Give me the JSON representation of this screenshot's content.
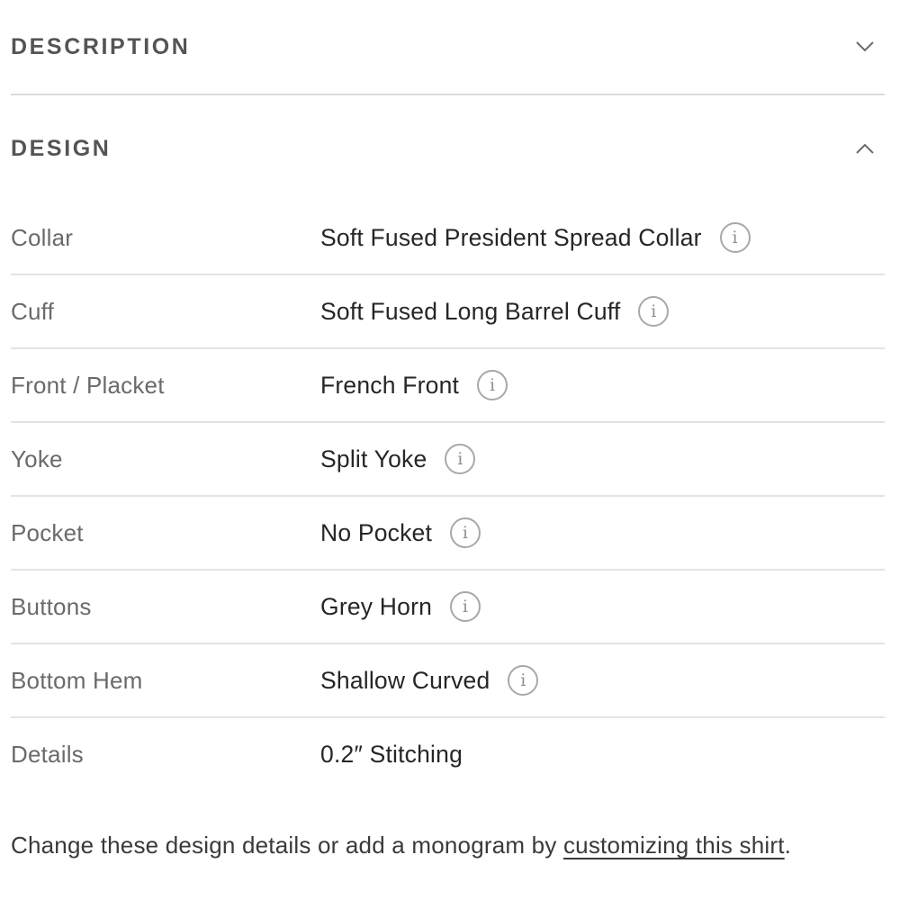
{
  "description": {
    "title": "DESCRIPTION",
    "state": "collapsed",
    "toggle_icon": "chevron-down-icon"
  },
  "design": {
    "title": "DESIGN",
    "state": "expanded",
    "toggle_icon": "chevron-up-icon",
    "rows": [
      {
        "label": "Collar",
        "value": "Soft Fused President Spread Collar",
        "info_icon": "i"
      },
      {
        "label": "Cuff",
        "value": "Soft Fused Long Barrel Cuff",
        "info_icon": "i"
      },
      {
        "label": "Front / Placket",
        "value": "French Front",
        "info_icon": "i"
      },
      {
        "label": "Yoke",
        "value": "Split Yoke",
        "info_icon": "i"
      },
      {
        "label": "Pocket",
        "value": "No Pocket",
        "info_icon": "i"
      },
      {
        "label": "Buttons",
        "value": "Grey Horn",
        "info_icon": "i"
      },
      {
        "label": "Bottom Hem",
        "value": "Shallow Curved",
        "info_icon": "i"
      },
      {
        "label": "Details",
        "value": "0.2″ Stitching"
      }
    ]
  },
  "footer": {
    "text_before": "Change these design details or add a monogram by ",
    "link_text": "customizing this shirt",
    "text_after": "."
  },
  "colors": {
    "heading": "#545454",
    "label": "#6a6a6a",
    "value": "#262626",
    "divider": "#e3e3e3",
    "info_icon": "#a8a8a8"
  }
}
